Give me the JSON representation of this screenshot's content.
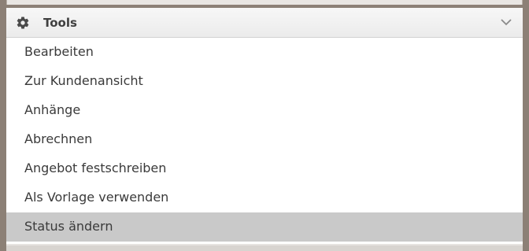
{
  "panel": {
    "title": "Tools",
    "icon": "gear-icon",
    "toggle_icon": "chevron-down-icon",
    "menu_items": [
      {
        "label": "Bearbeiten",
        "active": false
      },
      {
        "label": "Zur Kundenansicht",
        "active": false
      },
      {
        "label": "Anhänge",
        "active": false
      },
      {
        "label": "Abrechnen",
        "active": false
      },
      {
        "label": "Angebot festschreiben",
        "active": false
      },
      {
        "label": "Als Vorlage verwenden",
        "active": false
      },
      {
        "label": "Status ändern",
        "active": true
      }
    ]
  }
}
